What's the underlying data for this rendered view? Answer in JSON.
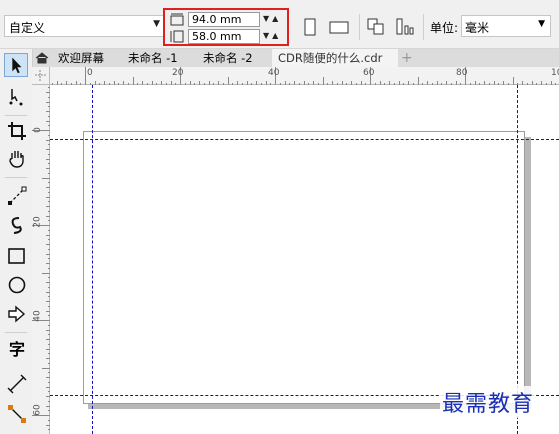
{
  "property_bar": {
    "preset_label": "自定义",
    "width_value": "94.0 mm",
    "height_value": "58.0 mm",
    "unit_label": "单位:",
    "unit_value": "毫米"
  },
  "tabs": [
    {
      "label": "欢迎屏幕",
      "active": false
    },
    {
      "label": "未命名 -1",
      "active": false
    },
    {
      "label": "未命名 -2",
      "active": false
    },
    {
      "label": "CDR随便的什么.cdr",
      "active": true
    }
  ],
  "new_tab_label": "+",
  "ruler": {
    "horizontal_labels": [
      "0",
      "20",
      "40",
      "60",
      "80",
      "10"
    ],
    "vertical_labels": [
      "0",
      "20",
      "40",
      "60"
    ]
  },
  "toolbox": {
    "text_tool_label": "字"
  },
  "watermark": "最需教育",
  "colors": {
    "highlight_border": "#e02020",
    "guideline": "#1010c0",
    "watermark": "#1a2fb5"
  }
}
